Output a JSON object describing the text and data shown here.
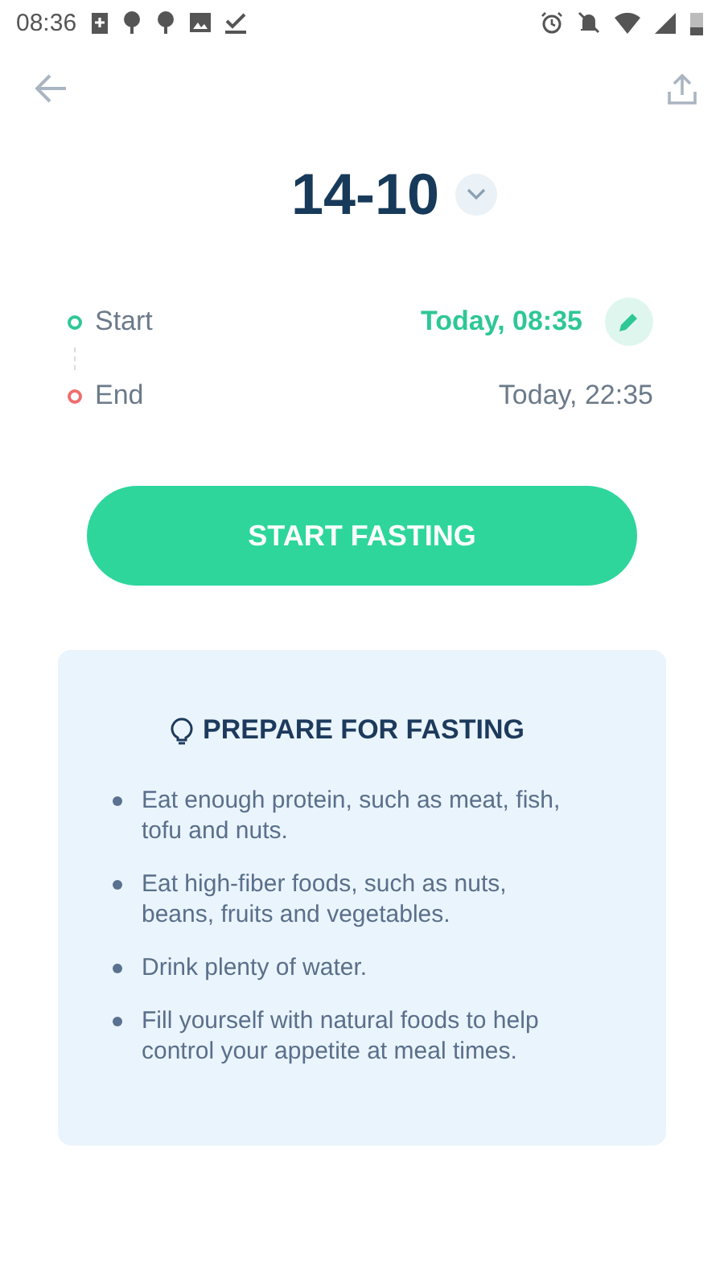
{
  "status_bar": {
    "time": "08:36"
  },
  "plan": {
    "title": "14-10"
  },
  "schedule": [
    {
      "kind": "start",
      "label": "Start",
      "time": "Today, 08:35",
      "color": "#2ec795"
    },
    {
      "kind": "end",
      "label": "End",
      "time": "Today, 22:35",
      "color": "#ef6e6e"
    }
  ],
  "primary_button": "START FASTING",
  "tips": {
    "title": "PREPARE FOR FASTING",
    "items": [
      "Eat enough protein, such as meat, fish, tofu and nuts.",
      "Eat high-fiber foods, such as nuts, beans, fruits and vegetables.",
      "Drink plenty of water.",
      "Fill yourself with natural foods to help control your appetite at meal times."
    ]
  }
}
